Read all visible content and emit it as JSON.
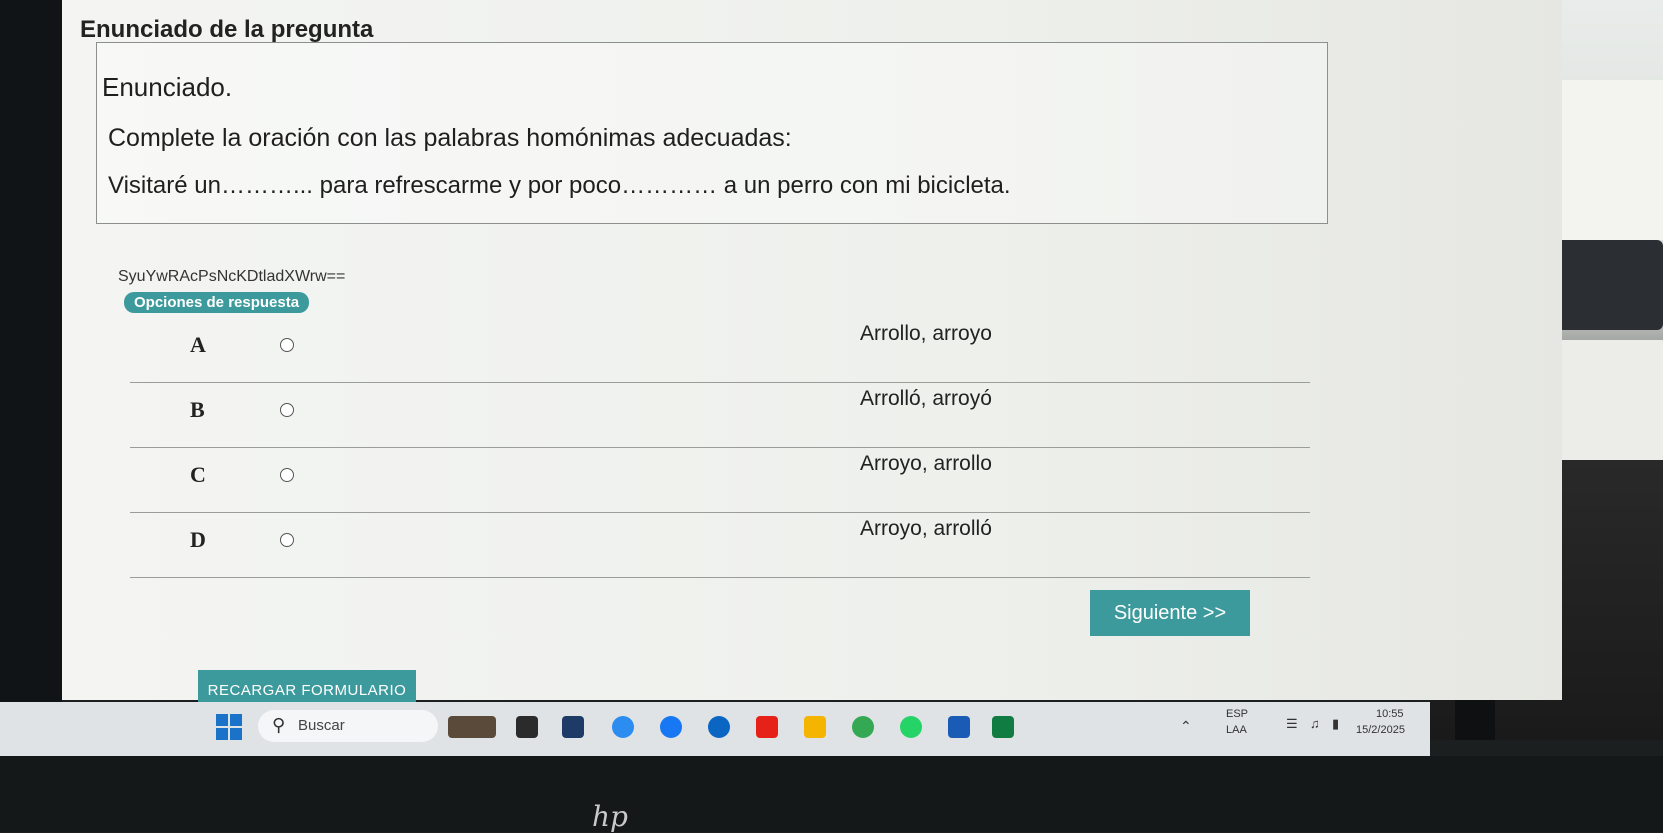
{
  "question": {
    "header": "Enunciado de la pregunta",
    "title": "Enunciado.",
    "instruction": "Complete la oración con las palabras homónimas adecuadas:",
    "sentence": "Visitaré un………... para refrescarme y por poco………… a un perro con mi bicicleta.",
    "code": "SyuYwRAcPsNcKDtladXWrw=="
  },
  "options": {
    "badge": "Opciones de respuesta",
    "items": [
      {
        "letter": "A",
        "text": "Arrollo, arroyo"
      },
      {
        "letter": "B",
        "text": "Arrolló, arroyó"
      },
      {
        "letter": "C",
        "text": "Arroyo, arrollo"
      },
      {
        "letter": "D",
        "text": "Arroyo, arrolló"
      }
    ]
  },
  "buttons": {
    "next": "Siguiente >>",
    "reload": "RECARGAR FORMULARIO"
  },
  "taskbar": {
    "search_placeholder": "Buscar",
    "lang_top": "ESP",
    "lang_bottom": "LAA",
    "time": "10:55",
    "date": "15/2/2025"
  },
  "brand": "hp"
}
